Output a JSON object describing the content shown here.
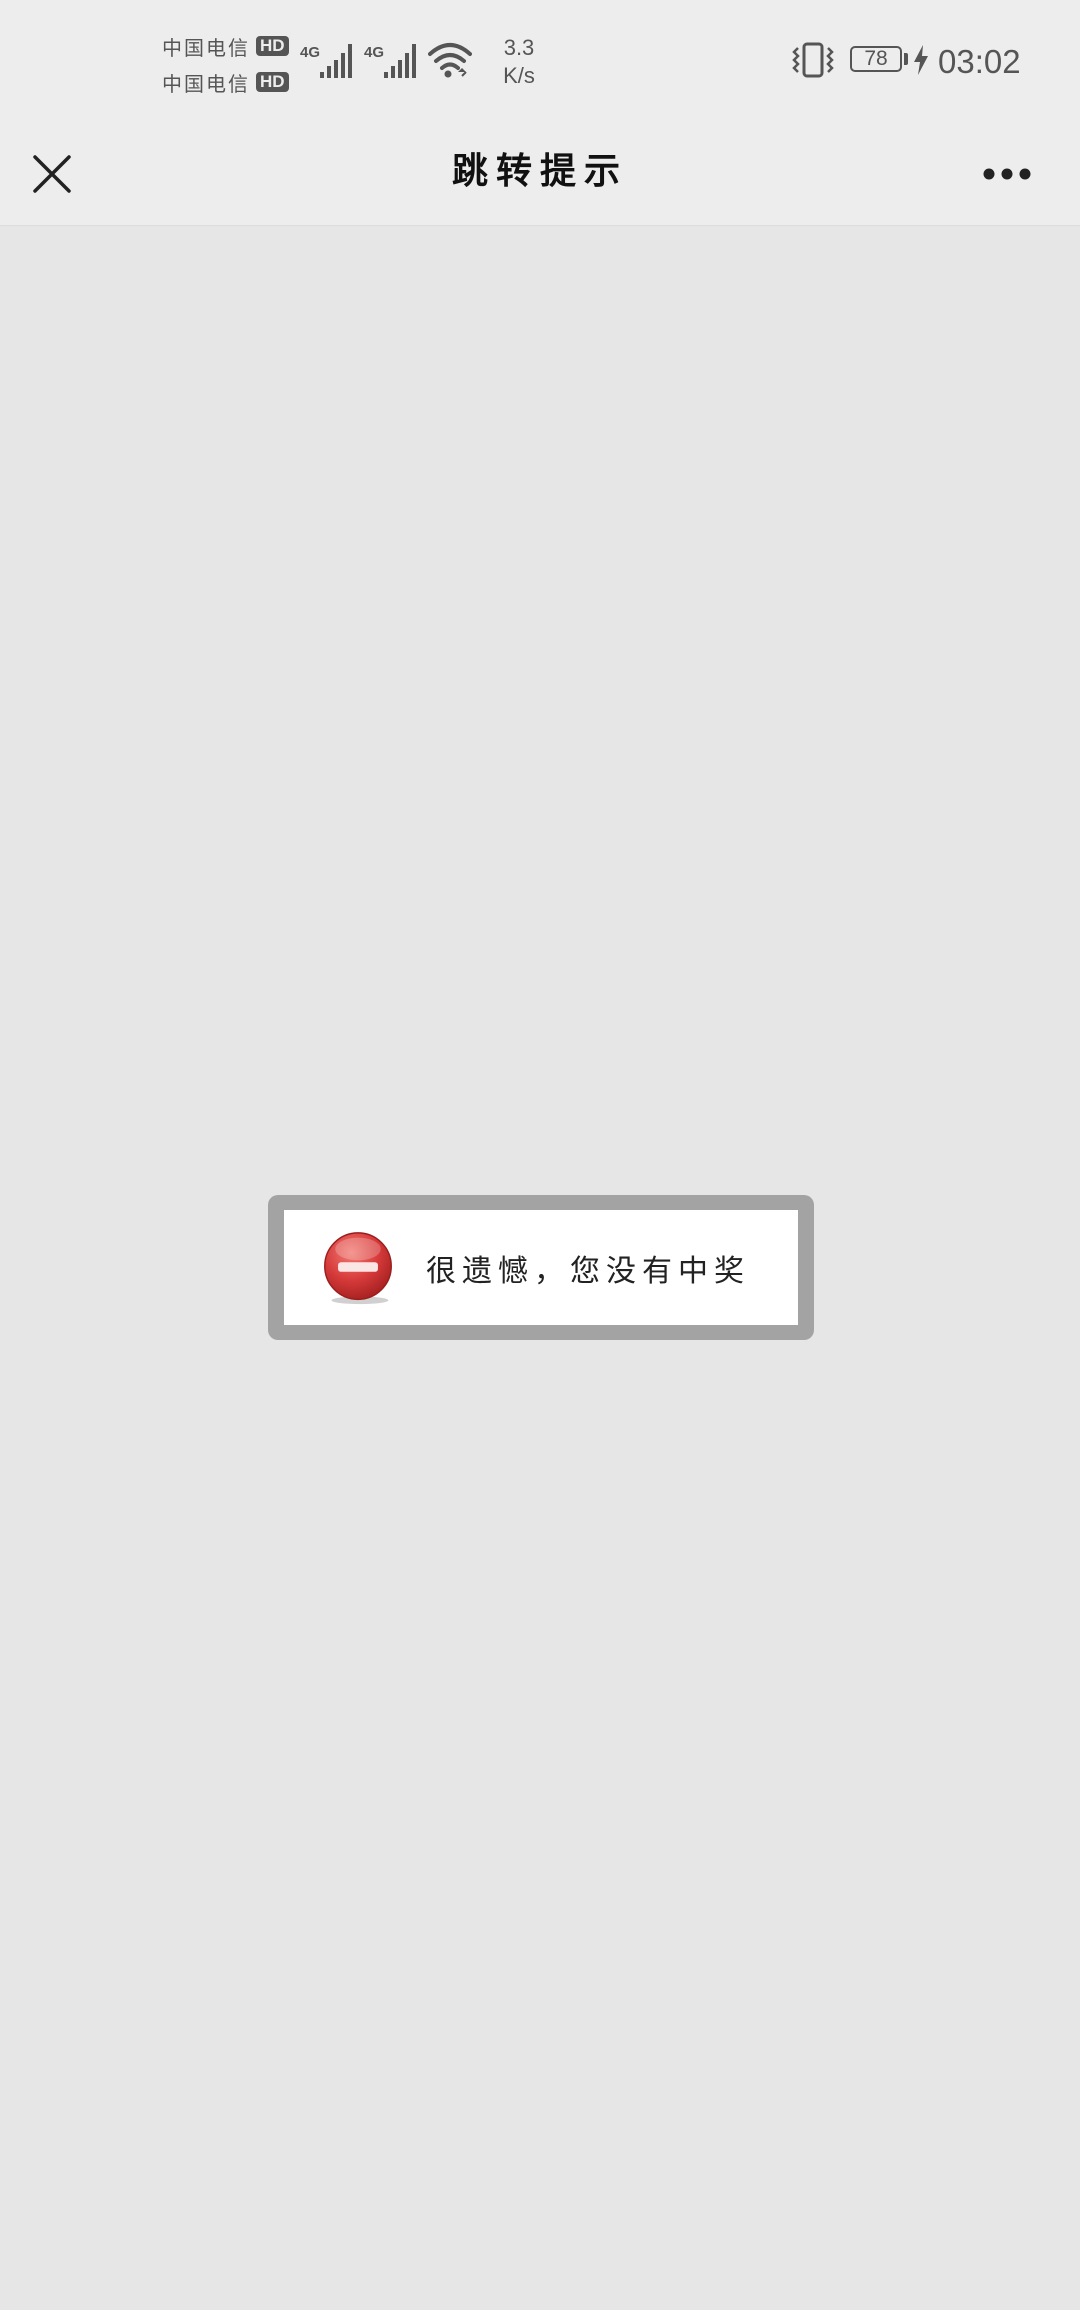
{
  "status_bar": {
    "carriers": [
      {
        "name": "中国电信",
        "badge": "HD"
      },
      {
        "name": "中国电信",
        "badge": "HD"
      }
    ],
    "network_type_1": "4G",
    "network_type_2": "4G",
    "net_speed_value": "3.3",
    "net_speed_unit": "K/s",
    "battery_level": "78",
    "time": "03:02",
    "icons": [
      "signal-icon",
      "wifi-icon",
      "vibrate-icon",
      "battery-icon",
      "charging-icon"
    ]
  },
  "title_bar": {
    "title": "跳转提示",
    "close_icon": "close-icon",
    "more_icon": "more-icon"
  },
  "dialog": {
    "icon": "error-icon",
    "message": "很遗憾，您没有中奖"
  },
  "colors": {
    "background": "#e6e6e6",
    "bar_background": "#ededed",
    "dialog_border": "#a3a3a3",
    "error_red": "#d63a3a"
  }
}
